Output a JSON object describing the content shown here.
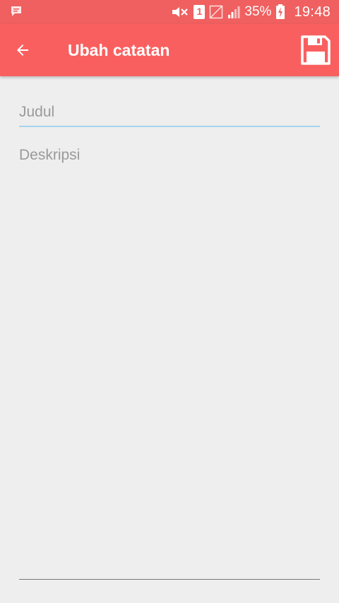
{
  "status_bar": {
    "battery_percent": "35%",
    "time": "19:48",
    "sim_label": "1",
    "icons": [
      "message-notification-icon",
      "mute-icon",
      "sim-icon",
      "no-signal-icon",
      "signal-icon",
      "charging-battery-icon"
    ]
  },
  "app_bar": {
    "title": "Ubah catatan",
    "back_icon": "arrow-back-icon",
    "save_icon": "floppy-save-icon"
  },
  "form": {
    "title_placeholder": "Judul",
    "title_value": "",
    "description_placeholder": "Deskripsi",
    "description_value": ""
  },
  "colors": {
    "app_bar": "#fa5f5f",
    "status_bar": "#f06060",
    "background": "#eeeeee",
    "title_underline": "#a7d3ee",
    "placeholder": "#9a9a9a"
  }
}
